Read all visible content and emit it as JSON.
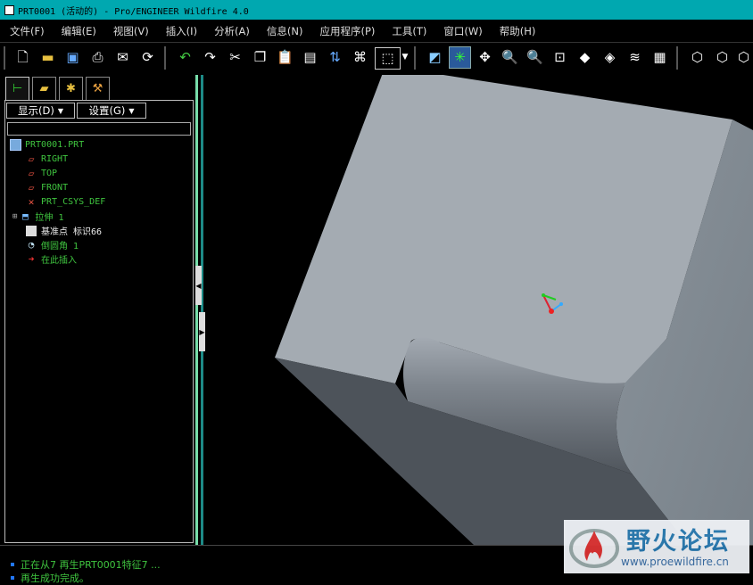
{
  "window": {
    "title": "PRT0001 (活动的) - Pro/ENGINEER Wildfire 4.0"
  },
  "menu": [
    "文件(F)",
    "编辑(E)",
    "视图(V)",
    "插入(I)",
    "分析(A)",
    "信息(N)",
    "应用程序(P)",
    "工具(T)",
    "窗口(W)",
    "帮助(H)"
  ],
  "toolbar": {
    "icons": [
      "new-file-icon",
      "open-icon",
      "save-icon",
      "print-icon",
      "send-icon",
      "regen-icon",
      "undo-icon",
      "redo-icon",
      "cut-icon",
      "copy-icon",
      "paste-icon",
      "paste-special-icon",
      "regenerate-icon",
      "find-icon",
      "select-box-icon",
      "repaint-icon",
      "spin-center-icon",
      "orient-icon",
      "zoom-in-icon",
      "zoom-out-icon",
      "refit-icon",
      "reorient-icon",
      "saved-views-icon",
      "layers-icon",
      "view-manager-icon",
      "wireframe-icon",
      "hidden-line-icon"
    ],
    "colors": {
      "selected": "#2a5a9a"
    }
  },
  "navigator": {
    "tabs": [
      "model-tree-icon",
      "folder-browser-icon",
      "favorites-icon",
      "connections-icon"
    ],
    "show_button": "显示(D)",
    "settings_button": "设置(G)",
    "filter_value": "",
    "tree": [
      {
        "label": "PRT0001.PRT",
        "icon": "part-icon",
        "color": "green"
      },
      {
        "label": "RIGHT",
        "icon": "datum-plane-icon",
        "color": "green"
      },
      {
        "label": "TOP",
        "icon": "datum-plane-icon",
        "color": "green"
      },
      {
        "label": "FRONT",
        "icon": "datum-plane-icon",
        "color": "green"
      },
      {
        "label": "PRT_CSYS_DEF",
        "icon": "csys-icon",
        "color": "green"
      },
      {
        "label": "拉伸 1",
        "icon": "extrude-icon",
        "color": "green"
      },
      {
        "label": "基准点 标识66",
        "icon": "datum-point-icon",
        "color": "white"
      },
      {
        "label": "倒圆角 1",
        "icon": "round-icon",
        "color": "green"
      },
      {
        "label": "在此插入",
        "icon": "insert-here-icon",
        "color": "green"
      }
    ]
  },
  "status": {
    "messages": [
      "正在从7 再生PRT0001特征7 ...",
      "再生成功完成。"
    ]
  },
  "watermark": {
    "cn": "野火论坛",
    "url": "www.proewildfire.cn"
  }
}
